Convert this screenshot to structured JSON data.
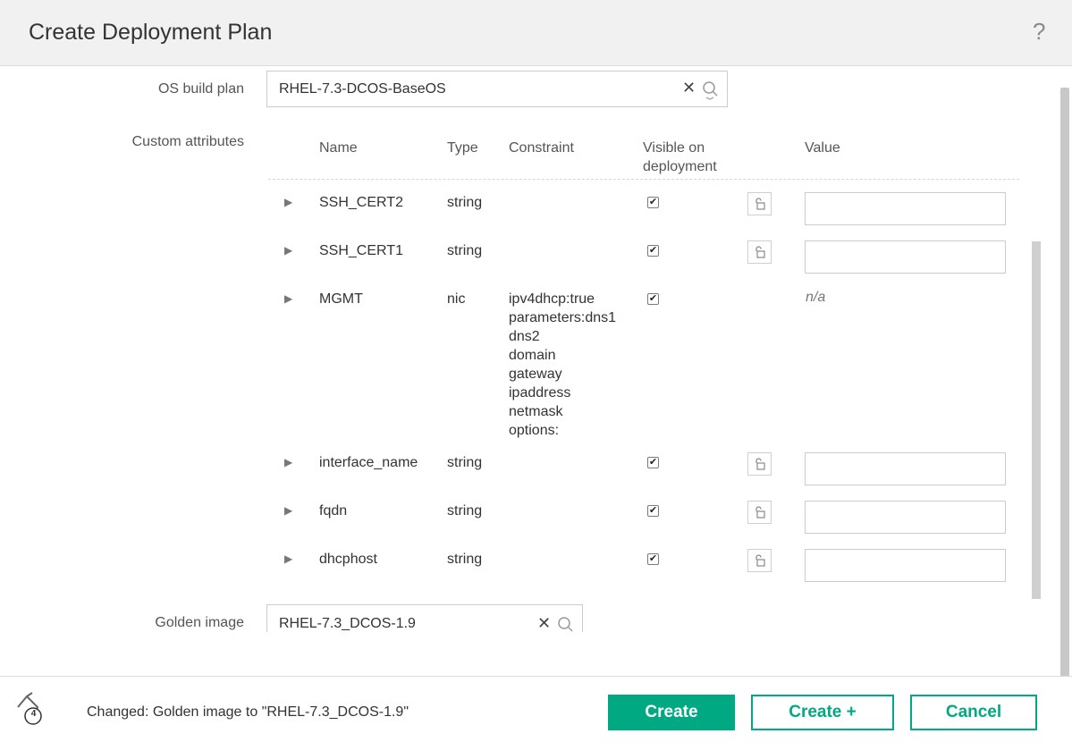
{
  "dialog": {
    "title": "Create Deployment Plan",
    "help_glyph": "?"
  },
  "os_build_plan": {
    "label": "OS build plan",
    "value": "RHEL-7.3-DCOS-BaseOS",
    "clear_glyph": "✕",
    "search_icon": "search-icon"
  },
  "custom_attributes": {
    "label": "Custom attributes",
    "columns": {
      "name": "Name",
      "type": "Type",
      "constraint": "Constraint",
      "visible_line1": "Visible on",
      "visible_line2": "deployment",
      "value": "Value"
    },
    "rows": [
      {
        "name": "SSH_CERT2",
        "type": "string",
        "constraint": "",
        "visible": true,
        "value": ""
      },
      {
        "name": "SSH_CERT1",
        "type": "string",
        "constraint": "",
        "visible": true,
        "value": ""
      },
      {
        "name": "MGMT",
        "type": "nic",
        "constraint_lines": [
          "ipv4dhcp:true",
          "parameters:dns1",
          "dns2",
          "domain",
          "gateway",
          "ipaddress",
          "netmask",
          "options:"
        ],
        "visible": true,
        "value": "n/a"
      },
      {
        "name": "interface_name",
        "type": "string",
        "constraint": "",
        "visible": true,
        "value": ""
      },
      {
        "name": "fqdn",
        "type": "string",
        "constraint": "",
        "visible": true,
        "value": ""
      },
      {
        "name": "dhcphost",
        "type": "string",
        "constraint": "",
        "visible": true,
        "value": ""
      }
    ]
  },
  "golden_image": {
    "label": "Golden image",
    "value": "RHEL-7.3_DCOS-1.9",
    "clear_glyph": "✕"
  },
  "footer": {
    "notification_count": "4",
    "status_message": "Changed: Golden image to \"RHEL-7.3_DCOS-1.9\"",
    "create_label": "Create",
    "create_plus_label": "Create +",
    "cancel_label": "Cancel"
  },
  "colors": {
    "accent": "#01a982",
    "header_bg": "#f1f1f1",
    "border": "#cccccc"
  }
}
